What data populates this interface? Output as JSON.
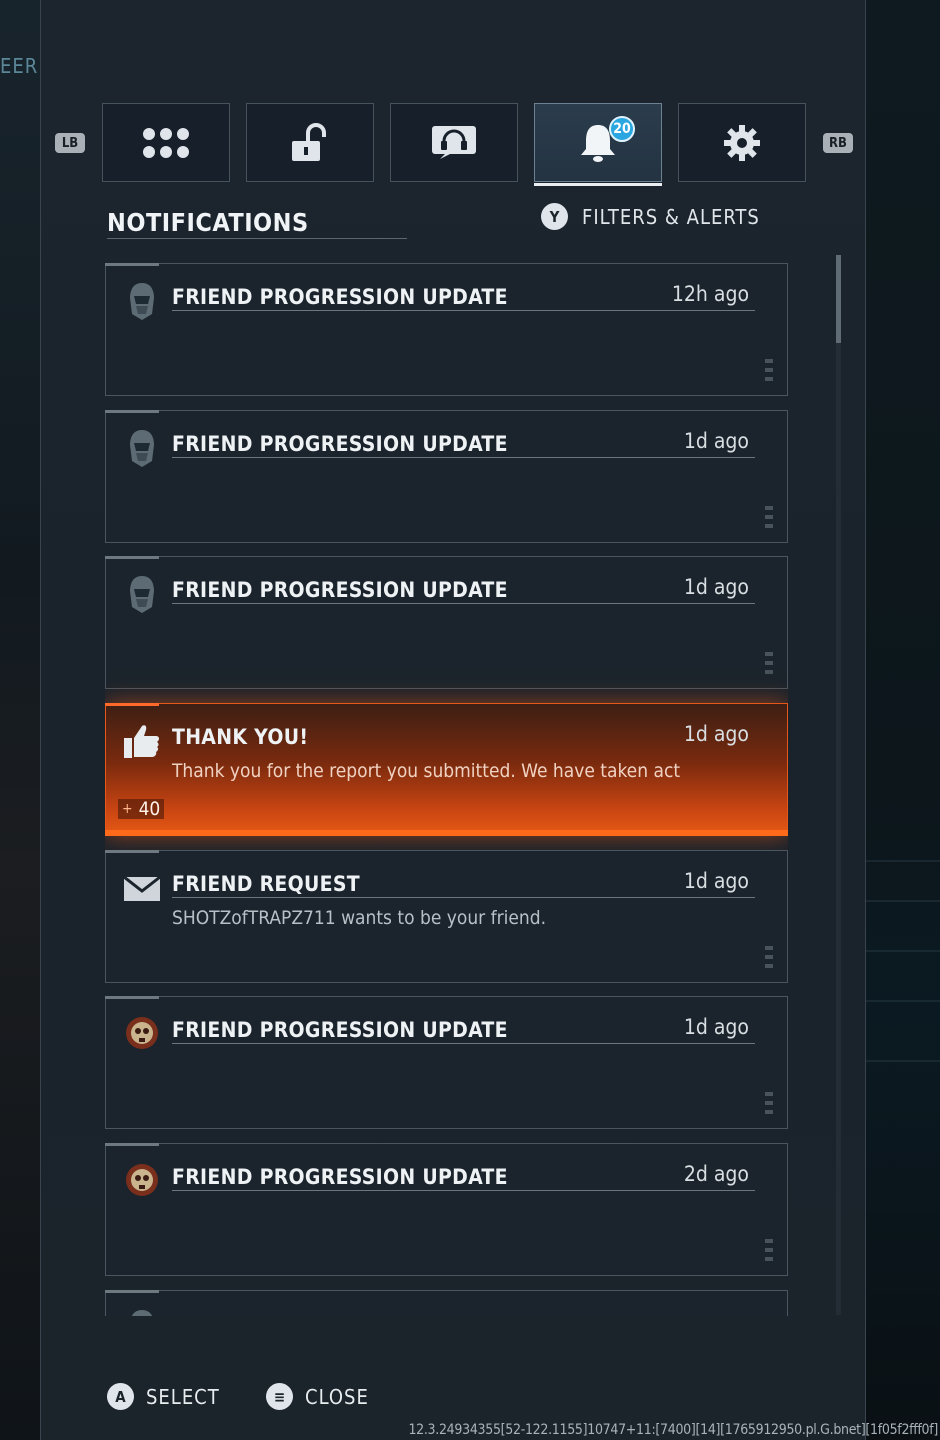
{
  "edge_text": "EER",
  "nav": {
    "left_bumper": "LB",
    "right_bumper": "RB",
    "tabs": [
      {
        "icon": "grid-dots-icon",
        "active": false
      },
      {
        "icon": "unlock-icon",
        "active": false
      },
      {
        "icon": "headset-icon",
        "active": false
      },
      {
        "icon": "bell-icon",
        "active": true,
        "badge": "20"
      },
      {
        "icon": "gear-icon",
        "active": false
      }
    ]
  },
  "header": {
    "title": "NOTIFICATIONS",
    "filters_button_glyph": "Y",
    "filters_label": "FILTERS & ALERTS"
  },
  "notifications": [
    {
      "icon": "helmet-avatar-icon",
      "title": "FRIEND PROGRESSION UPDATE",
      "time": "12h ago",
      "body": ""
    },
    {
      "icon": "helmet-avatar-icon",
      "title": "FRIEND PROGRESSION UPDATE",
      "time": "1d ago",
      "body": ""
    },
    {
      "icon": "helmet-avatar-icon",
      "title": "FRIEND PROGRESSION UPDATE",
      "time": "1d ago",
      "body": ""
    },
    {
      "icon": "thumbs-up-icon",
      "title": "THANK YOU!",
      "time": "1d ago",
      "body": "Thank you for the report you submitted. We have taken act",
      "reward": "40",
      "reward_prefix": "+",
      "highlighted": true
    },
    {
      "icon": "envelope-icon",
      "title": "FRIEND REQUEST",
      "time": "1d ago",
      "body": "SHOTZofTRAPZ711 wants to be your friend."
    },
    {
      "icon": "skull-avatar-icon",
      "title": "FRIEND PROGRESSION UPDATE",
      "time": "1d ago",
      "body": ""
    },
    {
      "icon": "skull-avatar-icon",
      "title": "FRIEND PROGRESSION UPDATE",
      "time": "2d ago",
      "body": ""
    },
    {
      "icon": "helmet-avatar-icon",
      "title": "",
      "time": "",
      "body": ""
    }
  ],
  "footer": {
    "select_glyph": "A",
    "select_label": "SELECT",
    "close_glyph": "≡",
    "close_label": "CLOSE"
  },
  "debug_text": "12.3.24934355[52-122.1155]10747+11:[7400][14][1765912950.pl.G.bnet][1f05f2fff0f]",
  "colors": {
    "highlight": "#e65a14",
    "badge": "#2aa6e0",
    "panel": "#1c252e"
  }
}
